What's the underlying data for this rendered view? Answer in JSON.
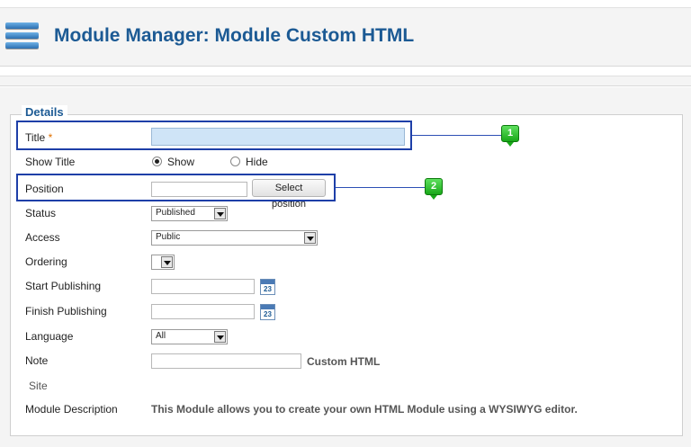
{
  "header": {
    "title": "Module Manager: Module Custom HTML",
    "icon": "module-icon"
  },
  "form": {
    "legend": "Details",
    "title": {
      "label": "Title",
      "required_mark": "*",
      "value": ""
    },
    "show_title": {
      "label": "Show Title",
      "options": [
        "Show",
        "Hide"
      ],
      "selected": "Show"
    },
    "position": {
      "label": "Position",
      "value": "",
      "button": "Select position"
    },
    "status": {
      "label": "Status",
      "value": "Published"
    },
    "access": {
      "label": "Access",
      "value": "Public"
    },
    "ordering": {
      "label": "Ordering",
      "value": ""
    },
    "start_publishing": {
      "label": "Start Publishing",
      "value": "",
      "calendar_text": "23"
    },
    "finish_publishing": {
      "label": "Finish Publishing",
      "value": "",
      "calendar_text": "23"
    },
    "language": {
      "label": "Language",
      "value": "All"
    },
    "note": {
      "label": "Note",
      "value": "",
      "module_type": "Custom HTML"
    },
    "site": {
      "label": "Site"
    },
    "module_description": {
      "label": "Module Description",
      "text": "This Module allows you to create your own HTML Module using a WYSIWYG editor."
    }
  },
  "callouts": [
    {
      "number": "1"
    },
    {
      "number": "2"
    }
  ],
  "colors": {
    "title": "#1c5a94",
    "callout_border": "#1e3fa8",
    "marker": "#19a819",
    "highlight_input": "#cfe4f7"
  }
}
